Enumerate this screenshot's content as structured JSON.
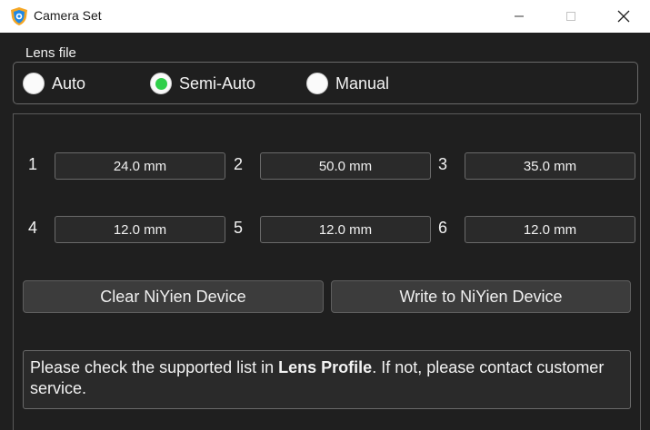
{
  "window": {
    "title": "Camera Set",
    "icon": "shield-logo-icon",
    "controls": [
      "minimize-icon",
      "maximize-icon",
      "close-icon"
    ]
  },
  "lens_file": {
    "legend": "Lens file",
    "options": [
      {
        "label": "Auto",
        "selected": false
      },
      {
        "label": "Semi-Auto",
        "selected": true
      },
      {
        "label": "Manual",
        "selected": false
      }
    ]
  },
  "lenses": [
    {
      "num": "1",
      "value": "24.0 mm"
    },
    {
      "num": "2",
      "value": "50.0 mm"
    },
    {
      "num": "3",
      "value": "35.0 mm"
    },
    {
      "num": "4",
      "value": "12.0 mm"
    },
    {
      "num": "5",
      "value": "12.0 mm"
    },
    {
      "num": "6",
      "value": "12.0 mm"
    }
  ],
  "buttons": {
    "clear": "Clear NiYien Device",
    "write": "Write to NiYien Device"
  },
  "notice": {
    "before": "Please check the supported list in ",
    "bold": "Lens Profile",
    "after": ". If not, please contact customer service."
  },
  "colors": {
    "background": "#1f1f1f",
    "selected_radio": "#2fcf4a",
    "titlebar": "#ffffff"
  }
}
